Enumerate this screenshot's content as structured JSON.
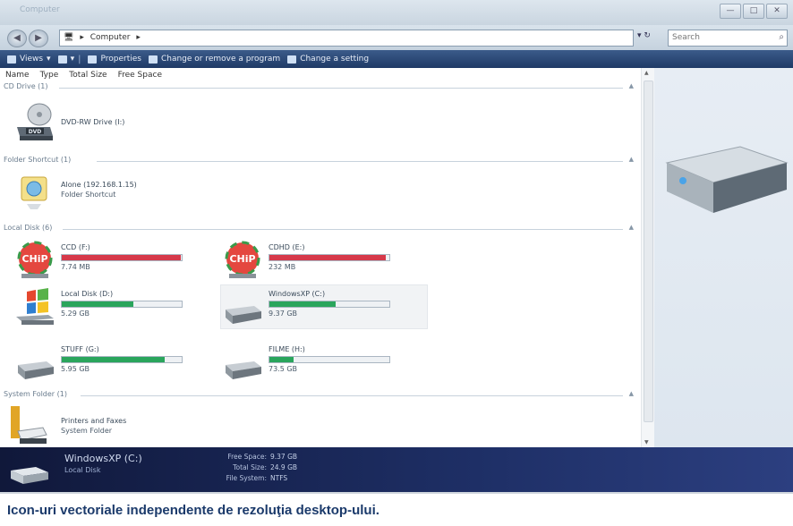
{
  "window": {
    "title": "Computer"
  },
  "address": {
    "breadcrumb": [
      "Computer"
    ],
    "search_placeholder": "Search"
  },
  "toolbar": {
    "items": [
      {
        "label": "Views",
        "icon": "views-icon"
      },
      {
        "label": "Properties",
        "icon": "properties-icon"
      },
      {
        "label": "Change or remove a program",
        "icon": "program-icon"
      },
      {
        "label": "Change a setting",
        "icon": "setting-icon"
      }
    ]
  },
  "columns": [
    "Name",
    "Type",
    "Total Size",
    "Free Space"
  ],
  "groups": {
    "cd": {
      "header": "CD Drive (1)",
      "items": [
        {
          "name": "DVD-RW Drive (I:)",
          "badge": "DVD"
        }
      ]
    },
    "shortcut": {
      "header": "Folder Shortcut (1)",
      "items": [
        {
          "name": "Alone (192.168.1.15)",
          "sub": "Folder Shortcut"
        }
      ]
    },
    "local": {
      "header": "Local Disk (6)",
      "items": [
        {
          "name": "CCD (F:)",
          "free": "7.74 MB",
          "used_fraction": 0.99,
          "bar_color": "#d6394a",
          "badge": "CHiP"
        },
        {
          "name": "CDHD (E:)",
          "free": "232 MB",
          "used_fraction": 0.97,
          "bar_color": "#d6394a",
          "badge": "CHiP"
        },
        {
          "name": "Local Disk (D:)",
          "free": "5.29 GB",
          "used_fraction": 0.6,
          "bar_color": "#2aa55c"
        },
        {
          "name": "WindowsXP (C:)",
          "free": "9.37 GB",
          "used_fraction": 0.55,
          "bar_color": "#2aa55c"
        },
        {
          "name": "STUFF (G:)",
          "free": "5.95 GB",
          "used_fraction": 0.86,
          "bar_color": "#2aa55c"
        },
        {
          "name": "FILME (H:)",
          "free": "73.5 GB",
          "used_fraction": 0.2,
          "bar_color": "#2aa55c"
        }
      ]
    },
    "system": {
      "header": "System Folder (1)",
      "items": [
        {
          "name": "Printers and Faxes",
          "sub": "System Folder"
        }
      ]
    }
  },
  "details": {
    "name": "WindowsXP (C:)",
    "type": "Local Disk",
    "free_space_label": "Free Space:",
    "free_space": "9.37 GB",
    "total_size_label": "Total Size:",
    "total_size": "24.9 GB",
    "file_system_label": "File System:",
    "file_system": "NTFS"
  },
  "caption": "Icon-uri vectoriale independente de rezoluţia desktop-ului."
}
